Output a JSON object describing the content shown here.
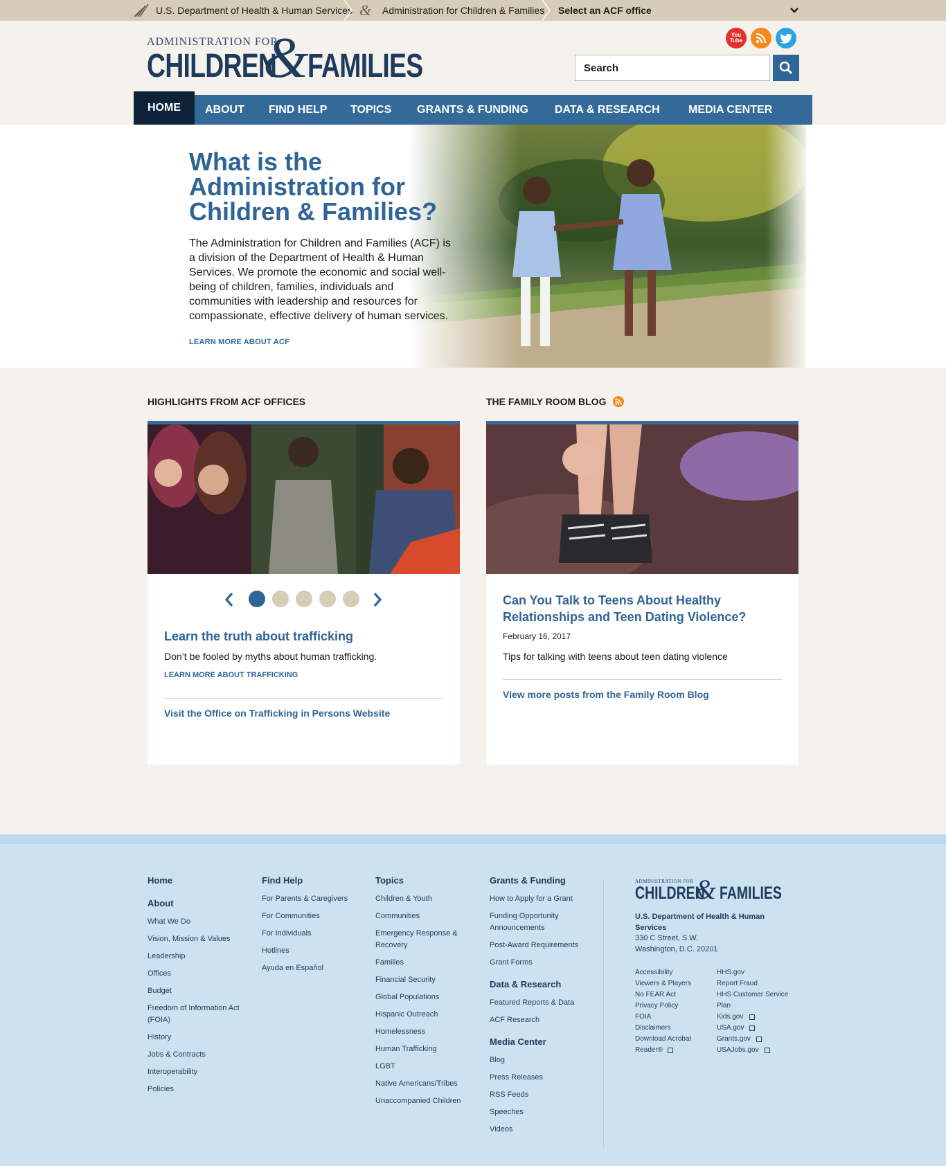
{
  "topbar": {
    "hhs": "U.S. Department of Health & Human Services",
    "acf": "Administration for Children & Families",
    "office_select": "Select an ACF office"
  },
  "logo": {
    "admin_for": "ADMINISTRATION FOR",
    "children": "CHILDREN",
    "amp": "&",
    "families": "FAMILIES"
  },
  "social": {
    "youtube": "You Tube",
    "rss": "RSS",
    "twitter": "Twitter"
  },
  "search": {
    "placeholder": "Search"
  },
  "nav": [
    "HOME",
    "ABOUT",
    "FIND HELP",
    "TOPICS",
    "GRANTS & FUNDING",
    "DATA & RESEARCH",
    "MEDIA CENTER"
  ],
  "hero": {
    "title": "What is the Administration for Children & Families?",
    "body": "The Administration for Children and Families (ACF) is a division of the Department of Health & Human Services. We promote the economic and social well-being of children, families, individuals and communities with leadership and resources for compassionate, effective delivery of human services.",
    "link": "LEARN MORE ABOUT ACF"
  },
  "highlights": {
    "heading": "HIGHLIGHTS FROM ACF OFFICES",
    "title": "Learn the truth about trafficking",
    "text": "Don’t be fooled by myths about human trafficking.",
    "link": "LEARN MORE ABOUT TRAFFICKING",
    "more": "Visit the Office on Trafficking in Persons Website",
    "slide_count": 5,
    "active_slide": 1
  },
  "blog": {
    "heading": "THE FAMILY ROOM BLOG",
    "title": "Can You Talk to Teens About Healthy Relationships and Teen Dating Violence?",
    "date": "February 16, 2017",
    "text": "Tips for talking with teens about teen dating violence",
    "more": "View more posts from the Family Room Blog"
  },
  "footer": {
    "col1": {
      "home": "Home",
      "about": "About",
      "links": [
        "What We Do",
        "Vision, Mission & Values",
        "Leadership",
        "Offices",
        "Budget",
        "Freedom of Information Act (FOIA)",
        "History",
        "Jobs & Contracts",
        "Interoperability",
        "Policies"
      ]
    },
    "col2": {
      "head": "Find Help",
      "links": [
        "For Parents & Caregivers",
        "For Communities",
        "For Individuals",
        "Hotlines",
        "Ayuda en Español"
      ]
    },
    "col3": {
      "head": "Topics",
      "links": [
        "Children & Youth",
        "Communities",
        "Emergency Response & Recovery",
        "Families",
        "Financial Security",
        "Global Populations",
        "Hispanic Outreach",
        "Homelessness",
        "Human Trafficking",
        "LGBT",
        "Native Americans/Tribes",
        "Unaccompanied Children"
      ]
    },
    "col4": {
      "grants_head": "Grants & Funding",
      "grants": [
        "How to Apply for a Grant",
        "Funding Opportunity Announcements",
        "Post-Award Requirements",
        "Grant Forms"
      ],
      "data_head": "Data & Research",
      "data": [
        "Featured Reports & Data",
        "ACF Research"
      ],
      "media_head": "Media Center",
      "media": [
        "Blog",
        "Press Releases",
        "RSS Feeds",
        "Speeches",
        "Videos"
      ]
    },
    "address": {
      "org": "U.S. Department of Health & Human Services",
      "street": "330 C Street, S.W.",
      "city": "Washington, D.C. 20201"
    },
    "small_left": [
      "Accessibility",
      "Viewers & Players",
      "No FEAR Act",
      "Privacy Policy",
      "FOIA",
      "Disclaimers",
      "Download Acrobat",
      "Reader®"
    ],
    "small_right": [
      "HHS.gov",
      "Report Fraud",
      "HHS Customer Service",
      "Plan",
      "Kids.gov",
      "USA.gov",
      "Grants.gov",
      "USAJobs.gov"
    ]
  },
  "colors": {
    "brand_blue": "#336a99",
    "link_blue": "#2f6496",
    "navy": "#1e3a5c",
    "tan": "#d6ccb7",
    "footer_bg": "#cde2f0"
  }
}
